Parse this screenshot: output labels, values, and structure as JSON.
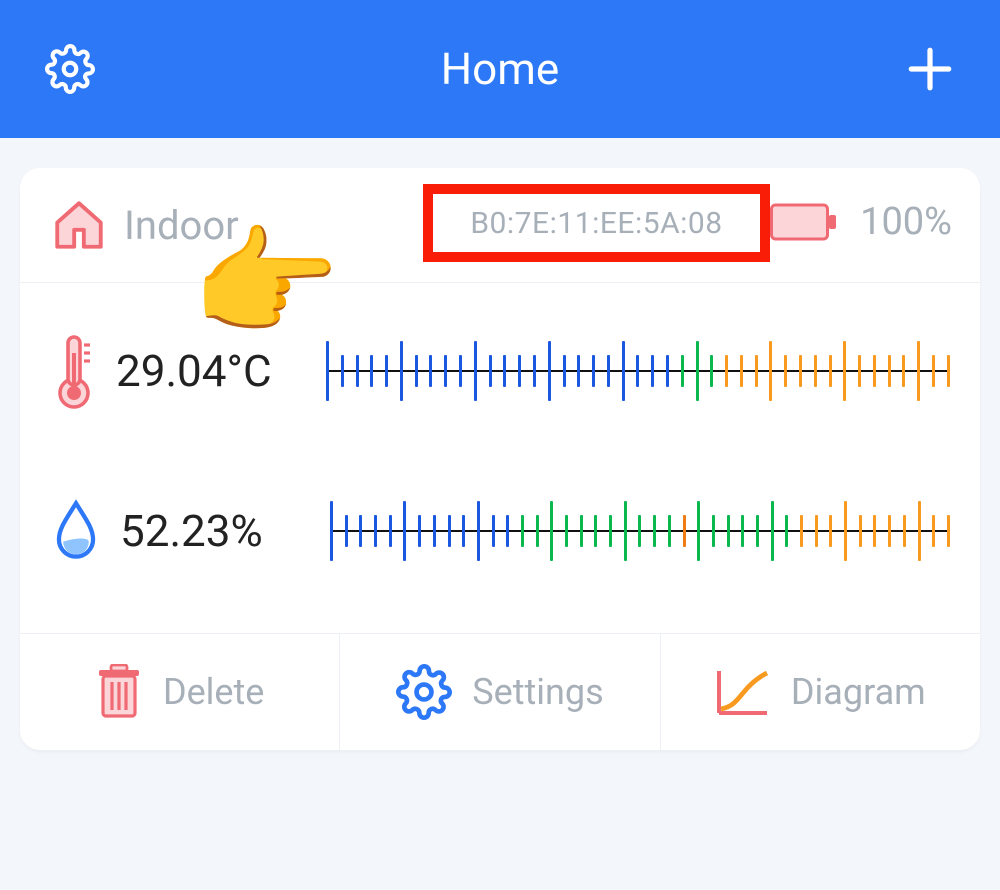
{
  "header": {
    "title": "Home"
  },
  "device": {
    "label": "Indoor",
    "mac": "B0:7E:11:EE:5A:08",
    "battery_percent": "100%"
  },
  "temperature": {
    "value": "29.04°C",
    "ticks": {
      "count": 43,
      "tall_every": 5,
      "segments": [
        {
          "color": "blue",
          "count": 24
        },
        {
          "color": "green",
          "count": 3
        },
        {
          "color": "orange",
          "count": 16
        }
      ]
    }
  },
  "humidity": {
    "value": "52.23%",
    "ticks": {
      "count": 43,
      "tall_every": 5,
      "segments": [
        {
          "color": "blue",
          "count": 13
        },
        {
          "color": "green",
          "count": 11
        },
        {
          "color": "odark",
          "count": 1
        },
        {
          "color": "green",
          "count": 7
        },
        {
          "color": "orange",
          "count": 11
        }
      ]
    }
  },
  "actions": {
    "delete": "Delete",
    "settings": "Settings",
    "diagram": "Diagram"
  },
  "colors": {
    "primary": "#2d78f6",
    "accent_red": "#f06a74",
    "muted": "#a7afb8",
    "highlight_box": "#f91c06"
  }
}
